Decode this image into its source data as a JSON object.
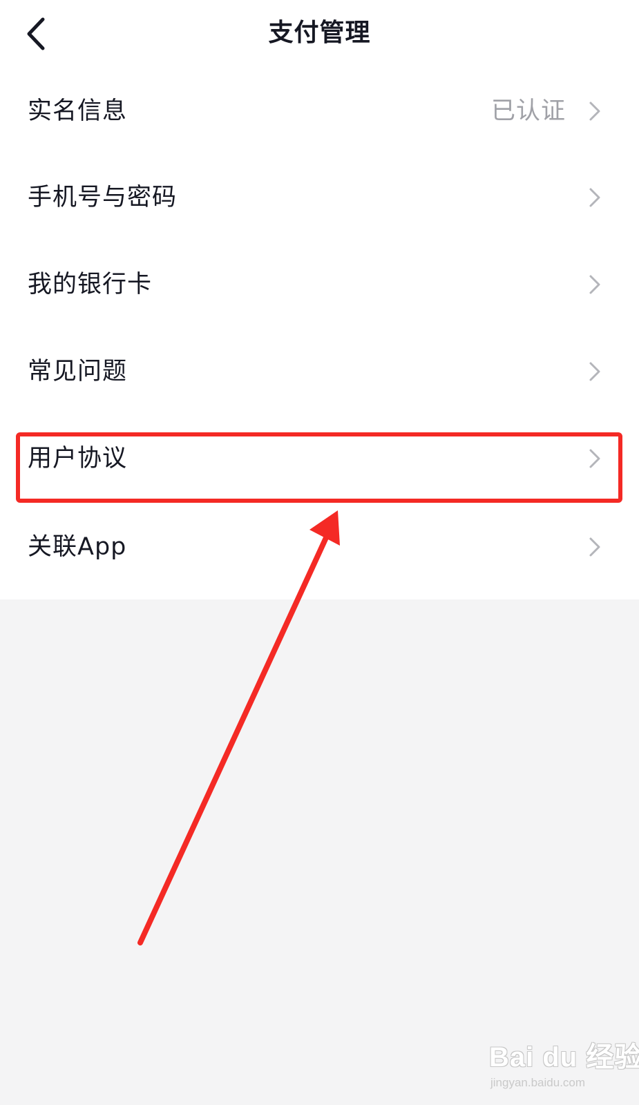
{
  "header": {
    "title": "支付管理",
    "back_icon": "chevron-left-icon"
  },
  "menu": {
    "items": [
      {
        "name": "real-name-info",
        "label": "实名信息",
        "value": "已认证"
      },
      {
        "name": "phone-password",
        "label": "手机号与密码",
        "value": ""
      },
      {
        "name": "bank-cards",
        "label": "我的银行卡",
        "value": ""
      },
      {
        "name": "faq",
        "label": "常见问题",
        "value": ""
      },
      {
        "name": "user-agreement",
        "label": "用户协议",
        "value": ""
      },
      {
        "name": "linked-app",
        "label": "关联App",
        "value": ""
      }
    ]
  },
  "annotation": {
    "highlight_color": "#f42a25",
    "target": "用户协议"
  },
  "watermark": {
    "main": "Bai du 经验",
    "sub": "jingyan.baidu.com"
  }
}
